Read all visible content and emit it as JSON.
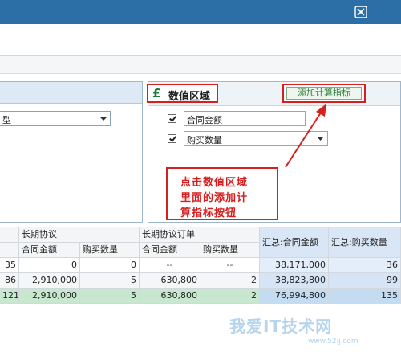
{
  "left_panel": {
    "combo_value": "型"
  },
  "value_area": {
    "title": "数值区域",
    "add_button": "添加计算指标",
    "fields": [
      {
        "label": "合同金额",
        "checked": true,
        "has_dropdown": false
      },
      {
        "label": "购买数量",
        "checked": true,
        "has_dropdown": true
      }
    ]
  },
  "annotation": {
    "lines": [
      "点击数值区域",
      "里面的添加计",
      "算指标按钮"
    ],
    "color": "#d61f1f"
  },
  "grid": {
    "group_headers": [
      "长期协议",
      "长期协议订单"
    ],
    "sub_headers": [
      "合同金额",
      "购买数量",
      "合同金额",
      "购买数量"
    ],
    "summary_headers": [
      "汇总:合同金额",
      "汇总:购买数量"
    ],
    "rows": [
      {
        "c0": "35",
        "c1": "0",
        "c2": "0",
        "c3": "--",
        "c4": "--",
        "c5": "",
        "s1": "38,171,000",
        "s2": "36"
      },
      {
        "c0": "86",
        "c1": "2,910,000",
        "c2": "5",
        "c3": "630,800",
        "c4": "",
        "c5": "2",
        "s1": "38,823,800",
        "s2": "99"
      },
      {
        "c0": "121",
        "c1": "2,910,000",
        "c2": "5",
        "c3": "630,800",
        "c4": "",
        "c5": "2",
        "s1": "76,994,800",
        "s2": "135"
      }
    ]
  },
  "watermark": {
    "text": "我爱IT技术网",
    "url": "www.52ij.com"
  }
}
